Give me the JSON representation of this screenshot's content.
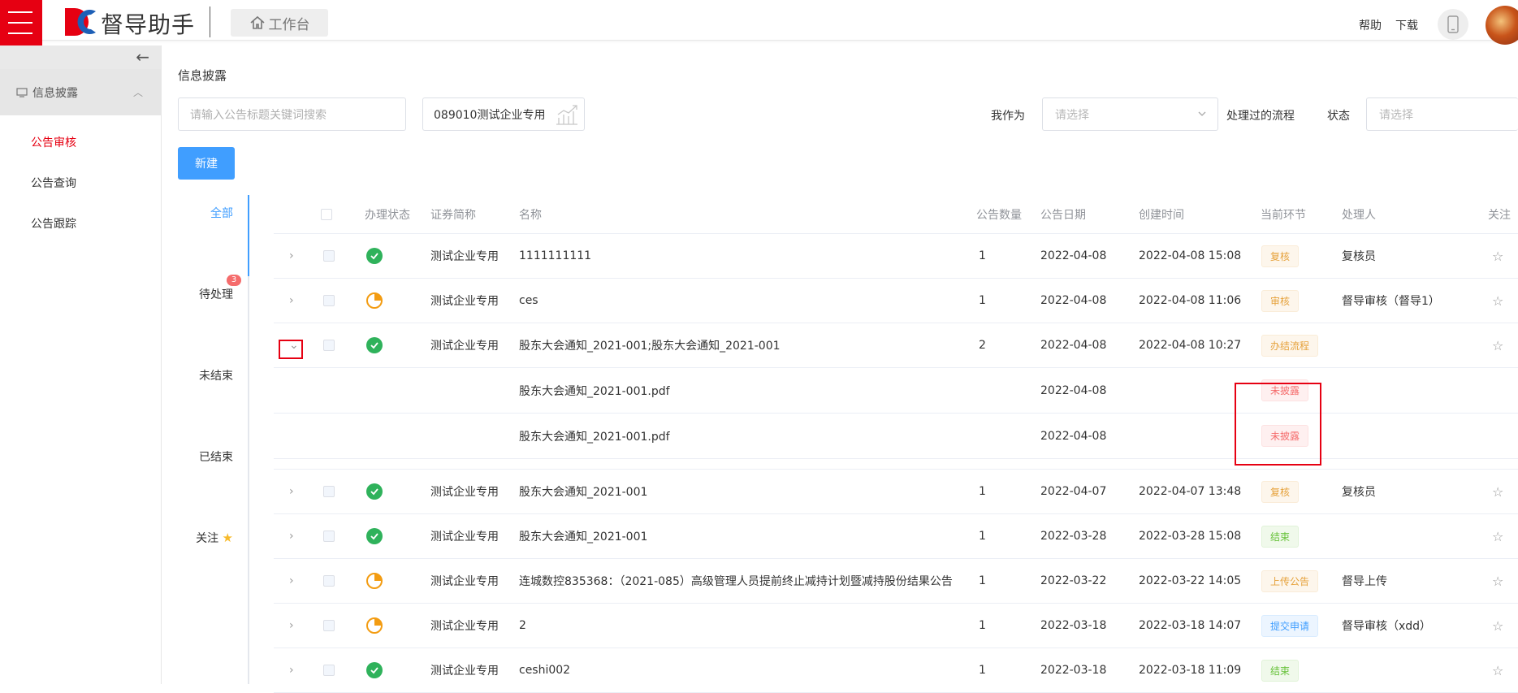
{
  "header": {
    "brand": "督导助手",
    "workbench": "工作台",
    "help": "帮助",
    "download": "下载"
  },
  "sidebar": {
    "group": "信息披露",
    "items": [
      {
        "label": "公告审核",
        "active": true
      },
      {
        "label": "公告查询",
        "active": false
      },
      {
        "label": "公告跟踪",
        "active": false
      }
    ]
  },
  "main": {
    "title": "信息披露",
    "search_placeholder": "请输入公告标题关键词搜索",
    "company": "089010测试企业专用",
    "role_label": "我作为",
    "role_placeholder": "请选择",
    "processed_label": "处理过的流程",
    "status_label": "状态",
    "status_placeholder": "请选择",
    "new_button": "新建"
  },
  "tabs": {
    "all": "全部",
    "pending": "待处理",
    "pending_count": "3",
    "unfinished": "未结束",
    "finished": "已结束",
    "follow": "关注"
  },
  "table": {
    "columns": {
      "status": "办理状态",
      "security": "证券简称",
      "name": "名称",
      "count": "公告数量",
      "date": "公告日期",
      "created": "创建时间",
      "stage": "当前环节",
      "handler": "处理人",
      "follow": "关注"
    },
    "rows": [
      {
        "status": "done",
        "security": "测试企业专用",
        "name": "1111111111",
        "count": "1",
        "date": "2022-04-08",
        "created": "2022-04-08 15:08",
        "stage": "复核",
        "stage_color": "orange",
        "handler": "复核员"
      },
      {
        "status": "partial",
        "security": "测试企业专用",
        "name": "ces",
        "count": "1",
        "date": "2022-04-08",
        "created": "2022-04-08 11:06",
        "stage": "审核",
        "stage_color": "orange",
        "handler": "督导审核（督导1）"
      },
      {
        "status": "done",
        "security": "测试企业专用",
        "name": "股东大会通知_2021-001;股东大会通知_2021-001",
        "count": "2",
        "date": "2022-04-08",
        "created": "2022-04-08 10:27",
        "stage": "办结流程",
        "stage_color": "orange",
        "handler": ""
      },
      {
        "status": "done",
        "security": "测试企业专用",
        "name": "股东大会通知_2021-001",
        "count": "1",
        "date": "2022-04-07",
        "created": "2022-04-07 13:48",
        "stage": "复核",
        "stage_color": "orange",
        "handler": "复核员"
      },
      {
        "status": "done",
        "security": "测试企业专用",
        "name": "股东大会通知_2021-001",
        "count": "1",
        "date": "2022-03-28",
        "created": "2022-03-28 15:08",
        "stage": "结束",
        "stage_color": "green",
        "handler": ""
      },
      {
        "status": "partial",
        "security": "测试企业专用",
        "name": "连城数控835368：（2021-085）高级管理人员提前终止减持计划暨减持股份结果公告",
        "count": "1",
        "date": "2022-03-22",
        "created": "2022-03-22 14:05",
        "stage": "上传公告",
        "stage_color": "orange",
        "handler": "督导上传"
      },
      {
        "status": "partial",
        "security": "测试企业专用",
        "name": "2",
        "count": "1",
        "date": "2022-03-18",
        "created": "2022-03-18 14:07",
        "stage": "提交申请",
        "stage_color": "blue",
        "handler": "督导审核（xdd）"
      },
      {
        "status": "done",
        "security": "测试企业专用",
        "name": "ceshi002",
        "count": "1",
        "date": "2022-03-18",
        "created": "2022-03-18 11:09",
        "stage": "结束",
        "stage_color": "green",
        "handler": ""
      }
    ],
    "sub_rows": [
      {
        "name": "股东大会通知_2021-001.pdf",
        "date": "2022-04-08",
        "stage": "未披露"
      },
      {
        "name": "股东大会通知_2021-001.pdf",
        "date": "2022-04-08",
        "stage": "未披露"
      }
    ]
  }
}
